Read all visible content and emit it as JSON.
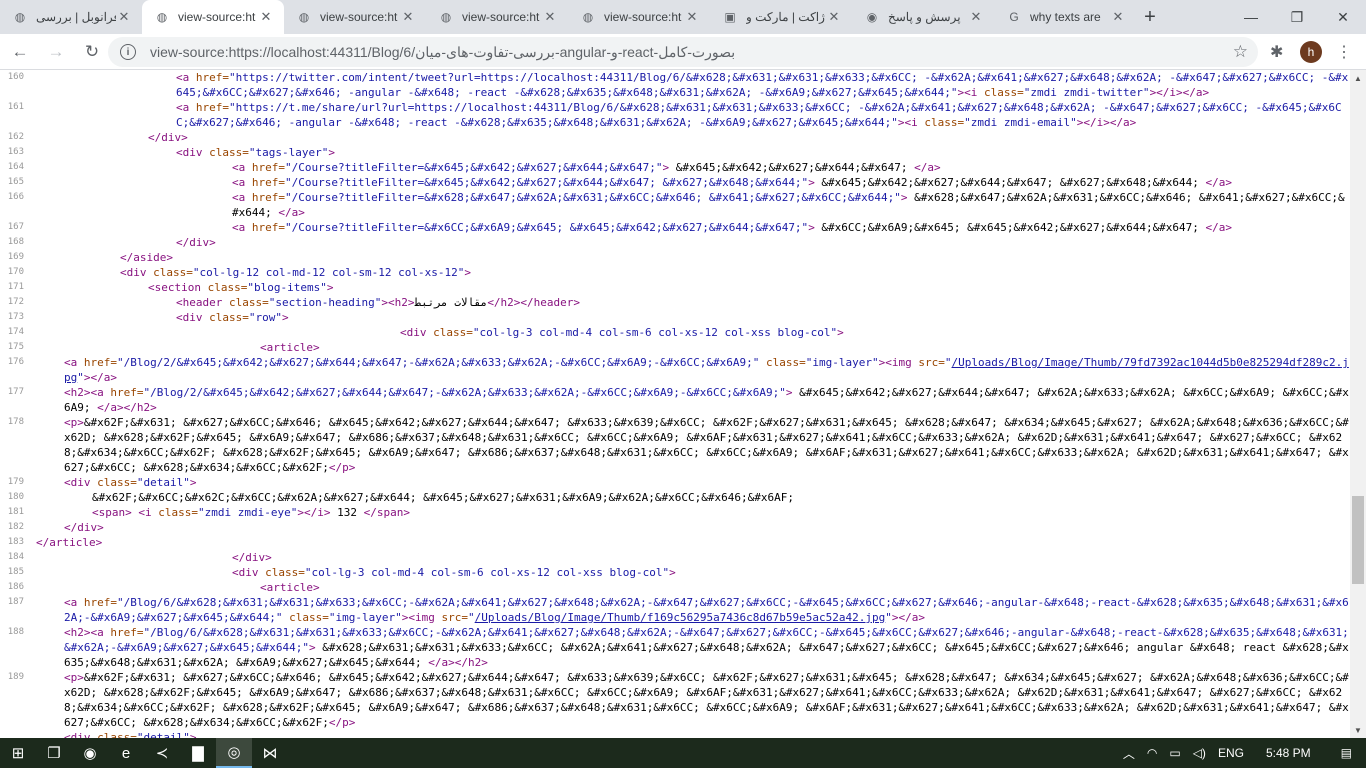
{
  "browser": {
    "tabs": [
      {
        "title": "فرانوبل | بررسی",
        "icon": "globe-icon",
        "active": false
      },
      {
        "title": "view-source:ht",
        "icon": "globe-icon",
        "active": true
      },
      {
        "title": "view-source:ht",
        "icon": "globe-icon",
        "active": false
      },
      {
        "title": "view-source:ht",
        "icon": "globe-icon",
        "active": false
      },
      {
        "title": "view-source:ht",
        "icon": "globe-icon",
        "active": false
      },
      {
        "title": "ژاکت | مارکت و",
        "icon": "cart-icon",
        "active": false
      },
      {
        "title": "پرسش و پاسخ",
        "icon": "circle-icon",
        "active": false
      },
      {
        "title": "why texts are",
        "icon": "google-icon",
        "active": false
      }
    ],
    "url": "view-source:https://localhost:44311/Blog/6/بررسی-تفاوت-های-میان-angular-و-react-بصورت-کامل",
    "avatar_letter": "h"
  },
  "source_lines": [
    {
      "n": "160",
      "html": "<span class=\"tag\">&lt;a</span> <span class=\"attr\">href=</span><span class=\"val\">\"https://twitter.com/intent/tweet?url=https://localhost:44311/Blog/6/&amp;#x628;&amp;#x631;&amp;#x631;&amp;#x633;&amp;#x6CC; -&amp;#x62A;&amp;#x641;&amp;#x627;&amp;#x648;&amp;#x62A; -&amp;#x647;&amp;#x627;&amp;#x6CC; -&amp;#x645;&amp;#x6CC;&amp;#x627;&amp;#x646; -angular -&amp;#x648; -react -&amp;#x628;&amp;#x635;&amp;#x648;&amp;#x631;&amp;#x62A; -&amp;#x6A9;&amp;#x627;&amp;#x645;&amp;#x644;\"</span><span class=\"tag\">&gt;&lt;i</span> <span class=\"attr\">class=</span><span class=\"val\">\"zmdi zmdi-twitter\"</span><span class=\"tag\">&gt;&lt;/i&gt;&lt;/a&gt;</span>",
      "indent": 40
    },
    {
      "n": "161",
      "html": "<span class=\"tag\">&lt;a</span> <span class=\"attr\">href=</span><span class=\"val\">\"https://t.me/share/url?url=https://localhost:44311/Blog/6/&amp;#x628;&amp;#x631;&amp;#x631;&amp;#x633;&amp;#x6CC; -&amp;#x62A;&amp;#x641;&amp;#x627;&amp;#x648;&amp;#x62A; -&amp;#x647;&amp;#x627;&amp;#x6CC; -&amp;#x645;&amp;#x6CC;&amp;#x627;&amp;#x646; -angular -&amp;#x648; -react -&amp;#x628;&amp;#x635;&amp;#x648;&amp;#x631;&amp;#x62A; -&amp;#x6A9;&amp;#x627;&amp;#x645;&amp;#x644;\"</span><span class=\"tag\">&gt;&lt;i</span> <span class=\"attr\">class=</span><span class=\"val\">\"zmdi zmdi-email\"</span><span class=\"tag\">&gt;&lt;/i&gt;&lt;/a&gt;</span>",
      "indent": 40
    },
    {
      "n": "162",
      "html": "<span class=\"tag\">&lt;/div&gt;</span>",
      "indent": 32
    },
    {
      "n": "163",
      "html": "<span class=\"tag\">&lt;div</span> <span class=\"attr\">class=</span><span class=\"val\">\"tags-layer\"</span><span class=\"tag\">&gt;</span>",
      "indent": 40
    },
    {
      "n": "164",
      "html": "<span class=\"tag\">&lt;a</span> <span class=\"attr\">href=</span><span class=\"val\">\"/Course?titleFilter=&amp;#x645;&amp;#x642;&amp;#x627;&amp;#x644;&amp;#x647;\"</span><span class=\"tag\">&gt;</span> &amp;#x645;&amp;#x642;&amp;#x627;&amp;#x644;&amp;#x647; <span class=\"tag\">&lt;/a&gt;</span>",
      "indent": 56
    },
    {
      "n": "165",
      "html": "<span class=\"tag\">&lt;a</span> <span class=\"attr\">href=</span><span class=\"val\">\"/Course?titleFilter=&amp;#x645;&amp;#x642;&amp;#x627;&amp;#x644;&amp;#x647; &amp;#x627;&amp;#x648;&amp;#x644;\"</span><span class=\"tag\">&gt;</span> &amp;#x645;&amp;#x642;&amp;#x627;&amp;#x644;&amp;#x647; &amp;#x627;&amp;#x648;&amp;#x644; <span class=\"tag\">&lt;/a&gt;</span>",
      "indent": 56
    },
    {
      "n": "166",
      "html": "<span class=\"tag\">&lt;a</span> <span class=\"attr\">href=</span><span class=\"val\">\"/Course?titleFilter=&amp;#x628;&amp;#x647;&amp;#x62A;&amp;#x631;&amp;#x6CC;&amp;#x646; &amp;#x641;&amp;#x627;&amp;#x6CC;&amp;#x644;\"</span><span class=\"tag\">&gt;</span> &amp;#x628;&amp;#x647;&amp;#x62A;&amp;#x631;&amp;#x6CC;&amp;#x646; &amp;#x641;&amp;#x627;&amp;#x6CC;&amp;#x644; <span class=\"tag\">&lt;/a&gt;</span>",
      "indent": 56
    },
    {
      "n": "167",
      "html": "<span class=\"tag\">&lt;a</span> <span class=\"attr\">href=</span><span class=\"val\">\"/Course?titleFilter=&amp;#x6CC;&amp;#x6A9;&amp;#x645; &amp;#x645;&amp;#x642;&amp;#x627;&amp;#x644;&amp;#x647;\"</span><span class=\"tag\">&gt;</span> &amp;#x6CC;&amp;#x6A9;&amp;#x645; &amp;#x645;&amp;#x642;&amp;#x627;&amp;#x644;&amp;#x647; <span class=\"tag\">&lt;/a&gt;</span>",
      "indent": 56
    },
    {
      "n": "168",
      "html": "<span class=\"tag\">&lt;/div&gt;</span>",
      "indent": 40
    },
    {
      "n": "169",
      "html": "<span class=\"tag\">&lt;/aside&gt;</span>",
      "indent": 24
    },
    {
      "n": "170",
      "html": "<span class=\"tag\">&lt;div</span> <span class=\"attr\">class=</span><span class=\"val\">\"col-lg-12 col-md-12 col-sm-12 col-xs-12\"</span><span class=\"tag\">&gt;</span>",
      "indent": 24
    },
    {
      "n": "171",
      "html": "<span class=\"tag\">&lt;section</span> <span class=\"attr\">class=</span><span class=\"val\">\"blog-items\"</span><span class=\"tag\">&gt;</span>",
      "indent": 32
    },
    {
      "n": "172",
      "html": "<span class=\"tag\">&lt;header</span> <span class=\"attr\">class=</span><span class=\"val\">\"section-heading\"</span><span class=\"tag\">&gt;&lt;h2&gt;</span>مقالات مرتبط<span class=\"tag\">&lt;/h2&gt;&lt;/header&gt;</span>",
      "indent": 40
    },
    {
      "n": "173",
      "html": "<span class=\"tag\">&lt;div</span> <span class=\"attr\">class=</span><span class=\"val\">\"row\"</span><span class=\"tag\">&gt;</span>",
      "indent": 40
    },
    {
      "n": "174",
      "html": "<span class=\"tag\">&lt;div</span> <span class=\"attr\">class=</span><span class=\"val\">\"col-lg-3 col-md-4 col-sm-6 col-xs-12 col-xss blog-col\"</span><span class=\"tag\">&gt;</span>",
      "indent": 104
    },
    {
      "n": "175",
      "html": "<span class=\"tag\">&lt;article&gt;</span>",
      "indent": 64
    },
    {
      "n": "176",
      "html": "<span class=\"tag\">&lt;a</span> <span class=\"attr\">href=</span><span class=\"val\">\"/Blog/2/&amp;#x645;&amp;#x642;&amp;#x627;&amp;#x644;&amp;#x647;-&amp;#x62A;&amp;#x633;&amp;#x62A;-&amp;#x6CC;&amp;#x6A9;-&amp;#x6CC;&amp;#x6A9;\"</span> <span class=\"attr\">class=</span><span class=\"val\">\"img-layer\"</span><span class=\"tag\">&gt;&lt;img</span> <span class=\"attr\">src=</span><span class=\"val\">\"<span class=\"link\">/Uploads/Blog/Image/Thumb/79fd7392ac1044d5b0e825294df289c2.jpg</span>\"</span><span class=\"tag\">&gt;&lt;/a&gt;</span>",
      "indent": 8
    },
    {
      "n": "177",
      "html": "<span class=\"tag\">&lt;h2&gt;&lt;a</span> <span class=\"attr\">href=</span><span class=\"val\">\"/Blog/2/&amp;#x645;&amp;#x642;&amp;#x627;&amp;#x644;&amp;#x647;-&amp;#x62A;&amp;#x633;&amp;#x62A;-&amp;#x6CC;&amp;#x6A9;-&amp;#x6CC;&amp;#x6A9;\"</span><span class=\"tag\">&gt;</span> &amp;#x645;&amp;#x642;&amp;#x627;&amp;#x644;&amp;#x647; &amp;#x62A;&amp;#x633;&amp;#x62A; &amp;#x6CC;&amp;#x6A9; &amp;#x6CC;&amp;#x6A9; <span class=\"tag\">&lt;/a&gt;&lt;/h2&gt;</span>",
      "indent": 8
    },
    {
      "n": "178",
      "html": "<span class=\"tag\">&lt;p&gt;</span>&amp;#x62F;&amp;#x631; &amp;#x627;&amp;#x6CC;&amp;#x646; &amp;#x645;&amp;#x642;&amp;#x627;&amp;#x644;&amp;#x647; &amp;#x633;&amp;#x639;&amp;#x6CC; &amp;#x62F;&amp;#x627;&amp;#x631;&amp;#x645; &amp;#x628;&amp;#x647; &amp;#x634;&amp;#x645;&amp;#x627; &amp;#x62A;&amp;#x648;&amp;#x636;&amp;#x6CC;&amp;#x62D; &amp;#x628;&amp;#x62F;&amp;#x645; &amp;#x6A9;&amp;#x647; &amp;#x686;&amp;#x637;&amp;#x648;&amp;#x631;&amp;#x6CC; &amp;#x6CC;&amp;#x6A9; &amp;#x6AF;&amp;#x631;&amp;#x627;&amp;#x641;&amp;#x6CC;&amp;#x633;&amp;#x62A; &amp;#x62D;&amp;#x631;&amp;#x641;&amp;#x647; &amp;#x627;&amp;#x6CC; &amp;#x628;&amp;#x634;&amp;#x6CC;&amp;#x62F; &amp;#x628;&amp;#x62F;&amp;#x645; &amp;#x6A9;&amp;#x647; &amp;#x686;&amp;#x637;&amp;#x648;&amp;#x631;&amp;#x6CC; &amp;#x6CC;&amp;#x6A9; &amp;#x6AF;&amp;#x631;&amp;#x627;&amp;#x641;&amp;#x6CC;&amp;#x633;&amp;#x62A; &amp;#x62D;&amp;#x631;&amp;#x641;&amp;#x647; &amp;#x627;&amp;#x6CC; &amp;#x628;&amp;#x634;&amp;#x6CC;&amp;#x62F;<span class=\"tag\">&lt;/p&gt;</span>",
      "indent": 8
    },
    {
      "n": "179",
      "html": "<span class=\"tag\">&lt;div</span> <span class=\"attr\">class=</span><span class=\"val\">\"detail\"</span><span class=\"tag\">&gt;</span>",
      "indent": 8
    },
    {
      "n": "180",
      "html": "&amp;#x62F;&amp;#x6CC;&amp;#x62C;&amp;#x6CC;&amp;#x62A;&amp;#x627;&amp;#x644; &amp;#x645;&amp;#x627;&amp;#x631;&amp;#x6A9;&amp;#x62A;&amp;#x6CC;&amp;#x646;&amp;#x6AF;",
      "indent": 16
    },
    {
      "n": "181",
      "html": "<span class=\"tag\">&lt;span&gt;</span> <span class=\"tag\">&lt;i</span> <span class=\"attr\">class=</span><span class=\"val\">\"zmdi zmdi-eye\"</span><span class=\"tag\">&gt;&lt;/i&gt;</span> 132 <span class=\"tag\">&lt;/span&gt;</span>",
      "indent": 16
    },
    {
      "n": "182",
      "html": "<span class=\"tag\">&lt;/div&gt;</span>",
      "indent": 8
    },
    {
      "n": "183",
      "html": "<span class=\"tag\">&lt;/article&gt;</span>",
      "indent": 0
    },
    {
      "n": "184",
      "html": "<span class=\"tag\">&lt;/div&gt;</span>",
      "indent": 56
    },
    {
      "n": "185",
      "html": "<span class=\"tag\">&lt;div</span> <span class=\"attr\">class=</span><span class=\"val\">\"col-lg-3 col-md-4 col-sm-6 col-xs-12 col-xss blog-col\"</span><span class=\"tag\">&gt;</span>",
      "indent": 56
    },
    {
      "n": "186",
      "html": "<span class=\"tag\">&lt;article&gt;</span>",
      "indent": 64
    },
    {
      "n": "187",
      "html": "<span class=\"tag\">&lt;a</span> <span class=\"attr\">href=</span><span class=\"val\">\"/Blog/6/&amp;#x628;&amp;#x631;&amp;#x631;&amp;#x633;&amp;#x6CC;-&amp;#x62A;&amp;#x641;&amp;#x627;&amp;#x648;&amp;#x62A;-&amp;#x647;&amp;#x627;&amp;#x6CC;-&amp;#x645;&amp;#x6CC;&amp;#x627;&amp;#x646;-angular-&amp;#x648;-react-&amp;#x628;&amp;#x635;&amp;#x648;&amp;#x631;&amp;#x62A;-&amp;#x6A9;&amp;#x627;&amp;#x645;&amp;#x644;\"</span> <span class=\"attr\">class=</span><span class=\"val\">\"img-layer\"</span><span class=\"tag\">&gt;&lt;img</span> <span class=\"attr\">src=</span><span class=\"val\">\"<span class=\"link\">/Uploads/Blog/Image/Thumb/f169c56295a7436c8d67b59e5ac52a42.jpg</span>\"</span><span class=\"tag\">&gt;&lt;/a&gt;</span>",
      "indent": 8
    },
    {
      "n": "188",
      "html": "<span class=\"tag\">&lt;h2&gt;&lt;a</span> <span class=\"attr\">href=</span><span class=\"val\">\"/Blog/6/&amp;#x628;&amp;#x631;&amp;#x631;&amp;#x633;&amp;#x6CC;-&amp;#x62A;&amp;#x641;&amp;#x627;&amp;#x648;&amp;#x62A;-&amp;#x647;&amp;#x627;&amp;#x6CC;-&amp;#x645;&amp;#x6CC;&amp;#x627;&amp;#x646;-angular-&amp;#x648;-react-&amp;#x628;&amp;#x635;&amp;#x648;&amp;#x631;&amp;#x62A;-&amp;#x6A9;&amp;#x627;&amp;#x645;&amp;#x644;\"</span><span class=\"tag\">&gt;</span> &amp;#x628;&amp;#x631;&amp;#x631;&amp;#x633;&amp;#x6CC; &amp;#x62A;&amp;#x641;&amp;#x627;&amp;#x648;&amp;#x62A; &amp;#x647;&amp;#x627;&amp;#x6CC; &amp;#x645;&amp;#x6CC;&amp;#x627;&amp;#x646; angular &amp;#x648; react &amp;#x628;&amp;#x635;&amp;#x648;&amp;#x631;&amp;#x62A; &amp;#x6A9;&amp;#x627;&amp;#x645;&amp;#x644; <span class=\"tag\">&lt;/a&gt;&lt;/h2&gt;</span>",
      "indent": 8
    },
    {
      "n": "189",
      "html": "<span class=\"tag\">&lt;p&gt;</span>&amp;#x62F;&amp;#x631; &amp;#x627;&amp;#x6CC;&amp;#x646; &amp;#x645;&amp;#x642;&amp;#x627;&amp;#x644;&amp;#x647; &amp;#x633;&amp;#x639;&amp;#x6CC; &amp;#x62F;&amp;#x627;&amp;#x631;&amp;#x645; &amp;#x628;&amp;#x647; &amp;#x634;&amp;#x645;&amp;#x627; &amp;#x62A;&amp;#x648;&amp;#x636;&amp;#x6CC;&amp;#x62D; &amp;#x628;&amp;#x62F;&amp;#x645; &amp;#x6A9;&amp;#x647; &amp;#x686;&amp;#x637;&amp;#x648;&amp;#x631;&amp;#x6CC; &amp;#x6CC;&amp;#x6A9; &amp;#x6AF;&amp;#x631;&amp;#x627;&amp;#x641;&amp;#x6CC;&amp;#x633;&amp;#x62A; &amp;#x62D;&amp;#x631;&amp;#x641;&amp;#x647; &amp;#x627;&amp;#x6CC; &amp;#x628;&amp;#x634;&amp;#x6CC;&amp;#x62F; &amp;#x628;&amp;#x62F;&amp;#x645; &amp;#x6A9;&amp;#x647; &amp;#x686;&amp;#x637;&amp;#x648;&amp;#x631;&amp;#x6CC; &amp;#x6CC;&amp;#x6A9; &amp;#x6AF;&amp;#x631;&amp;#x627;&amp;#x641;&amp;#x6CC;&amp;#x633;&amp;#x62A; &amp;#x62D;&amp;#x631;&amp;#x641;&amp;#x647; &amp;#x627;&amp;#x6CC; &amp;#x628;&amp;#x634;&amp;#x6CC;&amp;#x62F;<span class=\"tag\">&lt;/p&gt;</span>",
      "indent": 8
    },
    {
      "n": "",
      "html": "<span class=\"tag\">&lt;div</span> <span class=\"attr\">class=</span><span class=\"val\">\"detail\"</span><span class=\"tag\">&gt;</span>",
      "indent": 8
    }
  ],
  "taskbar": {
    "apps": [
      {
        "name": "start-icon",
        "glyph": "⊞",
        "active": false
      },
      {
        "name": "task-view-icon",
        "glyph": "❐",
        "active": false
      },
      {
        "name": "firefox-icon",
        "glyph": "◉",
        "active": false
      },
      {
        "name": "edge-icon",
        "glyph": "e",
        "active": false
      },
      {
        "name": "vscode-icon",
        "glyph": "≺",
        "active": false
      },
      {
        "name": "file-explorer-icon",
        "glyph": "▇",
        "active": false
      },
      {
        "name": "chrome-icon",
        "glyph": "◎",
        "active": true
      },
      {
        "name": "visual-studio-icon",
        "glyph": "⋈",
        "active": false
      }
    ],
    "language": "ENG",
    "time": "5:48 PM"
  }
}
